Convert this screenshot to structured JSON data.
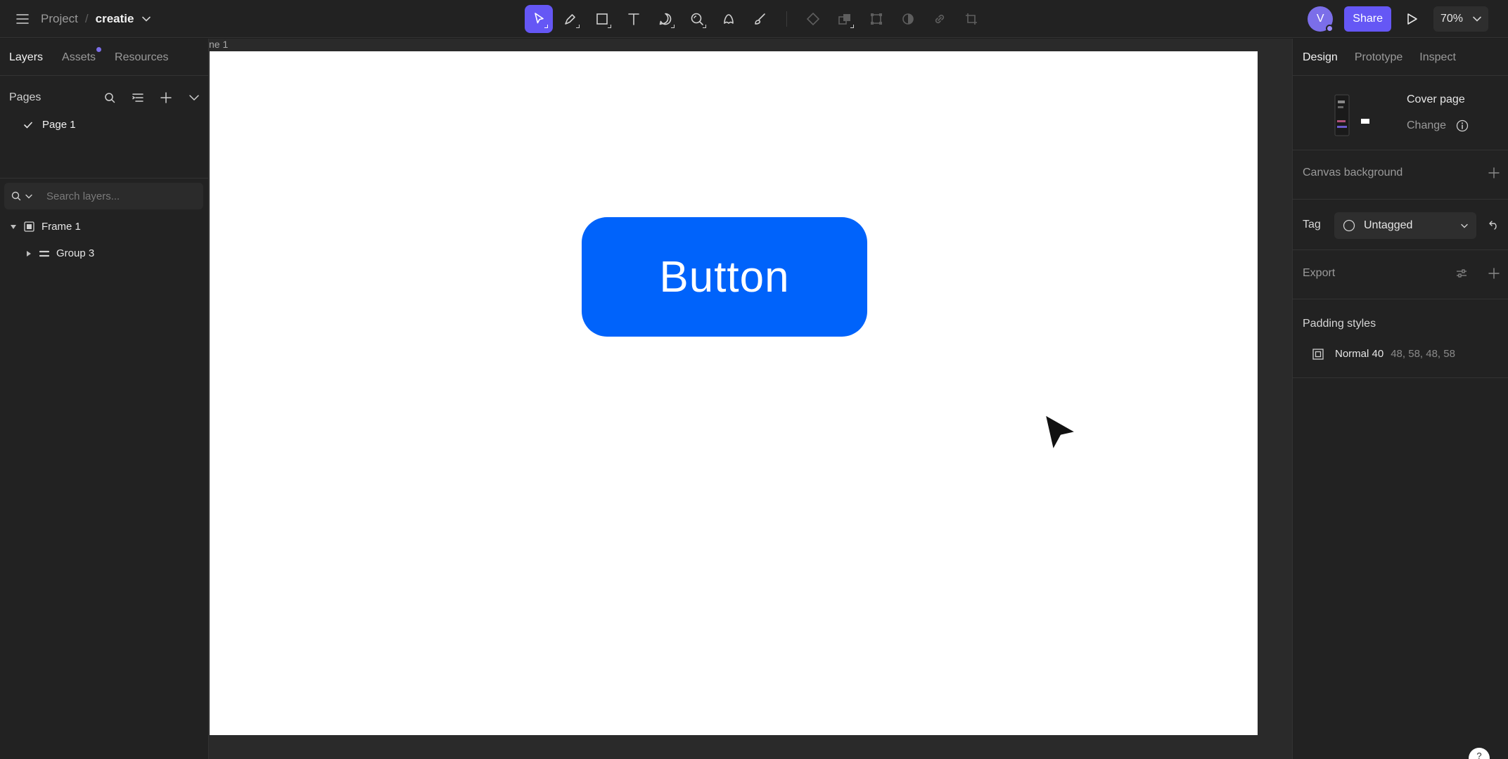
{
  "topbar": {
    "project_label": "Project",
    "separator": "/",
    "file_name": "creatie",
    "share_label": "Share",
    "avatar_initial": "V",
    "zoom": "70%",
    "tools": [
      {
        "name": "move",
        "active": true
      },
      {
        "name": "pen"
      },
      {
        "name": "rectangle"
      },
      {
        "name": "text"
      },
      {
        "name": "comment"
      },
      {
        "name": "zoom-search"
      },
      {
        "name": "shape-builder"
      },
      {
        "name": "brush"
      }
    ],
    "actions": [
      "component",
      "boolean",
      "transform",
      "mask",
      "link",
      "crop"
    ]
  },
  "left_panel": {
    "tabs": [
      "Layers",
      "Assets",
      "Resources"
    ],
    "active_tab": "Layers",
    "pages_title": "Pages",
    "pages": [
      {
        "name": "Page 1",
        "selected": true
      }
    ],
    "search_placeholder": "Search layers...",
    "layers": [
      {
        "name": "Frame 1",
        "type": "frame",
        "expanded": true
      },
      {
        "name": "Group 3",
        "type": "group",
        "expanded": false
      }
    ]
  },
  "canvas": {
    "frame_label": "ne 1",
    "button_text": "Button",
    "button_color": "#0063fb",
    "background": "#ffffff"
  },
  "right_panel": {
    "tabs": [
      "Design",
      "Prototype",
      "Inspect"
    ],
    "active_tab": "Design",
    "cover_title": "Cover page",
    "cover_change": "Change",
    "canvas_background": "Canvas background",
    "tag_label": "Tag",
    "tag_value": "Untagged",
    "export_label": "Export",
    "padding_title": "Padding styles",
    "padding_name": "Normal 40",
    "padding_values": "48, 58, 48, 58"
  },
  "colors": {
    "accent": "#6557f5",
    "panel": "#222222",
    "canvas_bg": "#2a2a2a"
  }
}
